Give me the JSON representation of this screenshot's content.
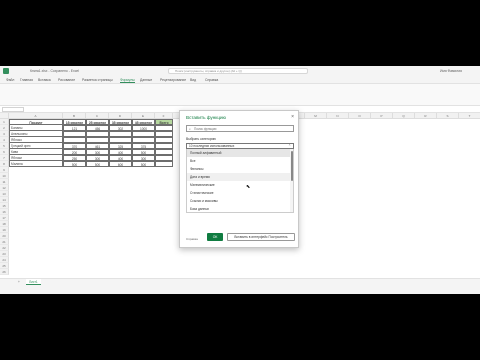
{
  "window": {
    "title": "Книга1.xlsx - Сохранено - Excel",
    "search_placeholder": "Поиск (инструменты, справка и другое) (Alt + Q)",
    "user": "Имя Фамилия"
  },
  "ribbon": {
    "tabs": [
      "Файл",
      "Главная",
      "Вставка",
      "Рисование",
      "Разметка страницы",
      "Формулы",
      "Данные",
      "Рецензирование",
      "Вид",
      "Справка"
    ],
    "active_tab": "Формулы"
  },
  "sheet": {
    "columns": [
      "A",
      "B",
      "C",
      "D",
      "E",
      "F",
      "G",
      "H",
      "I",
      "J",
      "K",
      "L",
      "M",
      "N",
      "O",
      "P",
      "Q",
      "R",
      "S",
      "T"
    ],
    "rows": [
      "1",
      "2",
      "3",
      "4",
      "5",
      "6",
      "7",
      "8",
      "9",
      "10",
      "11",
      "12",
      "13",
      "14",
      "15",
      "16",
      "17",
      "18",
      "19",
      "20",
      "21",
      "22",
      "23",
      "24",
      "25",
      "26"
    ],
    "headers": [
      "Продукт",
      "1й квартал",
      "2й квартал",
      "3й квартал",
      "4й квартал",
      "Всего"
    ],
    "data": [
      [
        "Бананы",
        "121",
        "456",
        "302",
        "1000"
      ],
      [
        "Апельсины",
        "",
        "",
        "",
        ""
      ],
      [
        "Яблоко",
        "",
        "",
        "",
        ""
      ],
      [
        "Грецкий орех",
        "370",
        "461",
        "325",
        "375"
      ],
      [
        "Киви",
        "200",
        "300",
        "400",
        "500"
      ],
      [
        "Яблоки",
        "250",
        "300",
        "400",
        "300"
      ],
      [
        "Малина",
        "500",
        "500",
        "600",
        "500"
      ]
    ],
    "tab_name": "Лист1"
  },
  "dialog": {
    "title": "Вставить функцию",
    "search_placeholder": "Поиск функции",
    "category_label": "Выбрать категорию",
    "category_value": "10 последних использованных",
    "options": [
      "Полный алфавитный",
      "Все",
      "Финансы",
      "Дата и время",
      "Математические",
      "Статистические",
      "Ссылки и массивы",
      "База данных"
    ],
    "ok": "ОК",
    "insert_to_fx": "Вставить в интерфейс Построитель",
    "help": "Справка"
  }
}
